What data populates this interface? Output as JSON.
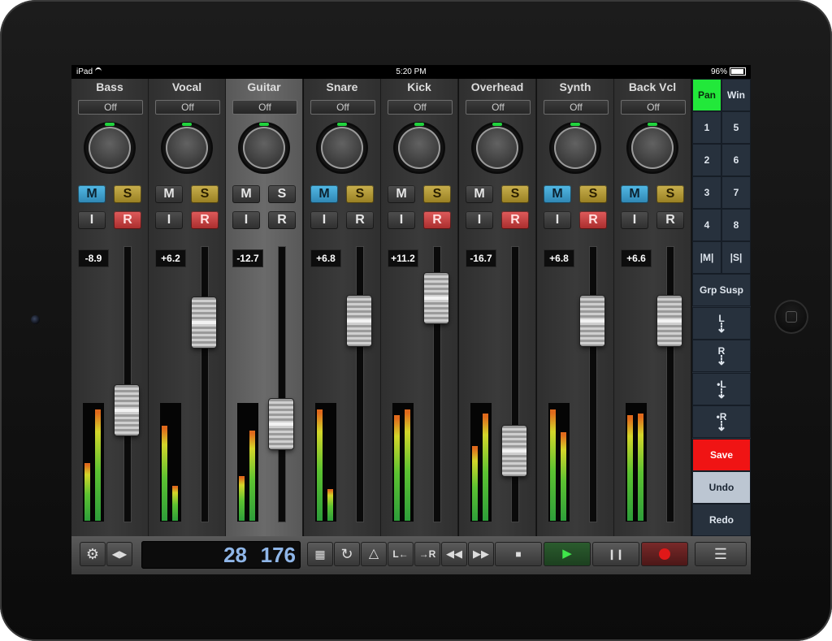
{
  "statusbar": {
    "device": "iPad",
    "time": "5:20 PM",
    "battery": "96%"
  },
  "channels": [
    {
      "name": "Bass",
      "automation": "Off",
      "mute": "M",
      "solo": "S",
      "input": "I",
      "record": "R",
      "gain": "-8.9",
      "mute_active": true,
      "solo_active": true,
      "record_active": true
    },
    {
      "name": "Vocal",
      "automation": "Off",
      "mute": "M",
      "solo": "S",
      "input": "I",
      "record": "R",
      "gain": "+6.2",
      "mute_active": false,
      "solo_active": true,
      "record_active": true
    },
    {
      "name": "Guitar",
      "automation": "Off",
      "mute": "M",
      "solo": "S",
      "input": "I",
      "record": "R",
      "gain": "-12.7",
      "mute_active": false,
      "solo_active": false,
      "record_active": false
    },
    {
      "name": "Snare",
      "automation": "Off",
      "mute": "M",
      "solo": "S",
      "input": "I",
      "record": "R",
      "gain": "+6.8",
      "mute_active": true,
      "solo_active": true,
      "record_active": false
    },
    {
      "name": "Kick",
      "automation": "Off",
      "mute": "M",
      "solo": "S",
      "input": "I",
      "record": "R",
      "gain": "+11.2",
      "mute_active": false,
      "solo_active": true,
      "record_active": true
    },
    {
      "name": "Overhead",
      "automation": "Off",
      "mute": "M",
      "solo": "S",
      "input": "I",
      "record": "R",
      "gain": "-16.7",
      "mute_active": false,
      "solo_active": true,
      "record_active": true
    },
    {
      "name": "Synth",
      "automation": "Off",
      "mute": "M",
      "solo": "S",
      "input": "I",
      "record": "R",
      "gain": "+6.8",
      "mute_active": true,
      "solo_active": true,
      "record_active": true
    },
    {
      "name": "Back Vcl",
      "automation": "Off",
      "mute": "M",
      "solo": "S",
      "input": "I",
      "record": "R",
      "gain": "+6.6",
      "mute_active": true,
      "solo_active": true,
      "record_active": false
    }
  ],
  "selected_channel": "Guitar",
  "fader_levels": [
    0.38,
    0.77,
    0.32,
    0.78,
    0.88,
    0.2,
    0.78,
    0.78
  ],
  "meter_levels": [
    [
      0.49,
      0.95
    ],
    [
      0.81,
      0.3
    ],
    [
      0.38,
      0.77
    ],
    [
      0.95,
      0.27
    ],
    [
      0.9,
      0.95
    ],
    [
      0.64,
      0.92
    ],
    [
      0.95,
      0.76
    ],
    [
      0.9,
      0.92
    ]
  ],
  "side_panel": {
    "pan": "Pan",
    "win": "Win",
    "banks": [
      "1",
      "5",
      "2",
      "6",
      "3",
      "7",
      "4",
      "8"
    ],
    "mute_all": "|M|",
    "solo_all": "|S|",
    "grp_susp": "Grp Susp",
    "loc_l": "L",
    "loc_r": "R",
    "set_l": "•L",
    "set_r": "•R",
    "save": "Save",
    "undo": "Undo",
    "redo": "Redo",
    "pan_color": "#22e83a",
    "save_color": "#f01414",
    "undo_color": "#bcc6d2"
  },
  "transport": {
    "counter_bars": "28",
    "counter_beats": "176",
    "to_left_locator": "L",
    "to_right_locator": "R",
    "play_color": "#2b5d2e",
    "record_color": "#e01818"
  }
}
